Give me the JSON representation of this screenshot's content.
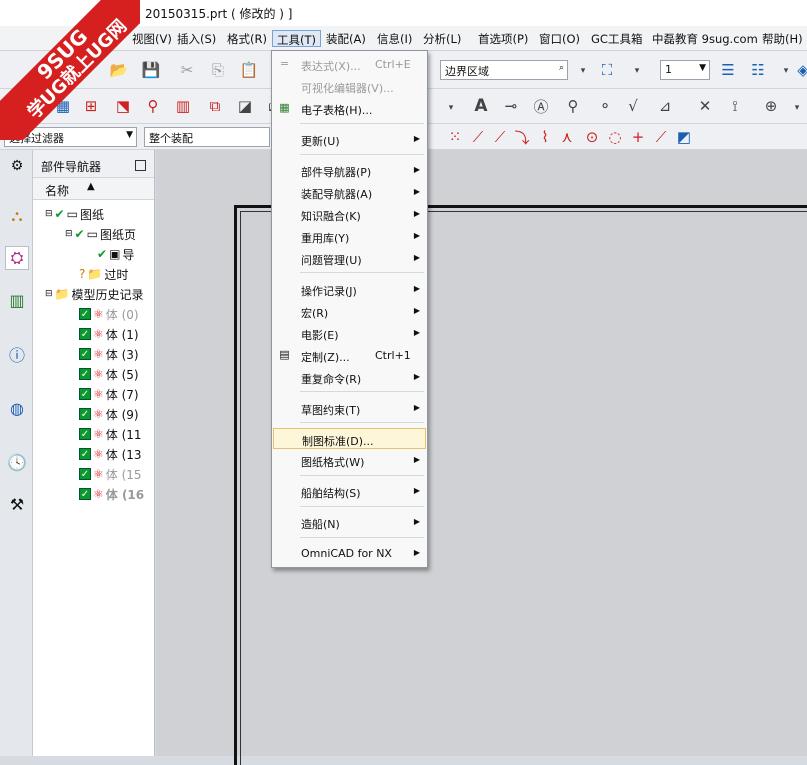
{
  "title": "20150315.prt  ( 修改的 ) ]",
  "menu": [
    {
      "label": "视图(V)"
    },
    {
      "label": "插入(S)"
    },
    {
      "label": "格式(R)"
    },
    {
      "label": "工具(T)"
    },
    {
      "label": "装配(A)"
    },
    {
      "label": "信息(I)"
    },
    {
      "label": "分析(L)"
    },
    {
      "label": "首选项(P)"
    },
    {
      "label": "窗口(O)"
    },
    {
      "label": "GC工具箱"
    },
    {
      "label": "中磊教育 9sug.com"
    },
    {
      "label": "帮助(H)"
    }
  ],
  "toolbar": {
    "region_combo": "边界区域",
    "count_combo": "1",
    "filter_combo": "选择过滤器",
    "assembly_combo": "整个装配"
  },
  "navigator": {
    "title": "部件导航器",
    "col_name": "名称",
    "nodes": [
      {
        "label": "图纸"
      },
      {
        "label": "图纸页"
      },
      {
        "label": "导"
      },
      {
        "label": "过时"
      },
      {
        "label": "模型历史记录"
      },
      {
        "label": "体 (0)"
      },
      {
        "label": "体 (1)"
      },
      {
        "label": "体 (3)"
      },
      {
        "label": "体 (5)"
      },
      {
        "label": "体 (7)"
      },
      {
        "label": "体 (9)"
      },
      {
        "label": "体 (11"
      },
      {
        "label": "体 (13"
      },
      {
        "label": "体 (15"
      },
      {
        "label": "体 (16"
      }
    ]
  },
  "tools_menu": [
    {
      "label": "表达式(X)...",
      "shortcut": "Ctrl+E"
    },
    {
      "label": "可视化编辑器(V)..."
    },
    {
      "label": "电子表格(H)..."
    },
    {
      "label": "更新(U)"
    },
    {
      "label": "部件导航器(P)"
    },
    {
      "label": "装配导航器(A)"
    },
    {
      "label": "知识融合(K)"
    },
    {
      "label": "重用库(Y)"
    },
    {
      "label": "问题管理(U)"
    },
    {
      "label": "操作记录(J)"
    },
    {
      "label": "宏(R)"
    },
    {
      "label": "电影(E)"
    },
    {
      "label": "定制(Z)...",
      "shortcut": "Ctrl+1"
    },
    {
      "label": "重复命令(R)"
    },
    {
      "label": "草图约束(T)"
    },
    {
      "label": "制图标准(D)..."
    },
    {
      "label": "图纸格式(W)"
    },
    {
      "label": "船舶结构(S)"
    },
    {
      "label": "造船(N)"
    },
    {
      "label": "OmniCAD for NX"
    }
  ],
  "watermark": {
    "line1": "9SUG",
    "line2": "学UG就上UG网"
  },
  "colors": {
    "menu_highlight": "#fdf6d8",
    "menu_active": "#dfe8f5",
    "watermark": "#d61f1f",
    "check": "#0a9a2c"
  }
}
